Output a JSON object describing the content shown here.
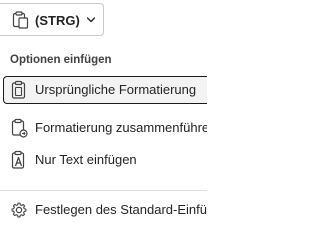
{
  "trigger": {
    "label": "(STRG)",
    "icon": "clipboard-icon",
    "chevron": "chevron-down-icon"
  },
  "menu": {
    "section_header": "Optionen einfügen",
    "items": [
      {
        "label": "Ursprüngliche Formatierung",
        "icon": "clipboard-keep-format-icon",
        "selected": true
      },
      {
        "label": "Formatierung zusammenführen",
        "icon": "clipboard-merge-format-icon",
        "selected": false
      },
      {
        "label": "Nur Text einfügen",
        "icon": "clipboard-text-only-icon",
        "selected": false
      }
    ],
    "settings_item": {
      "label": "Festlegen des Standard-Einfügens",
      "icon": "gear-icon"
    }
  },
  "colors": {
    "accent_border": "#1b1b1b",
    "selected_bg": "#f3f3f3",
    "text": "#242424",
    "divider": "#e0e0e0"
  }
}
